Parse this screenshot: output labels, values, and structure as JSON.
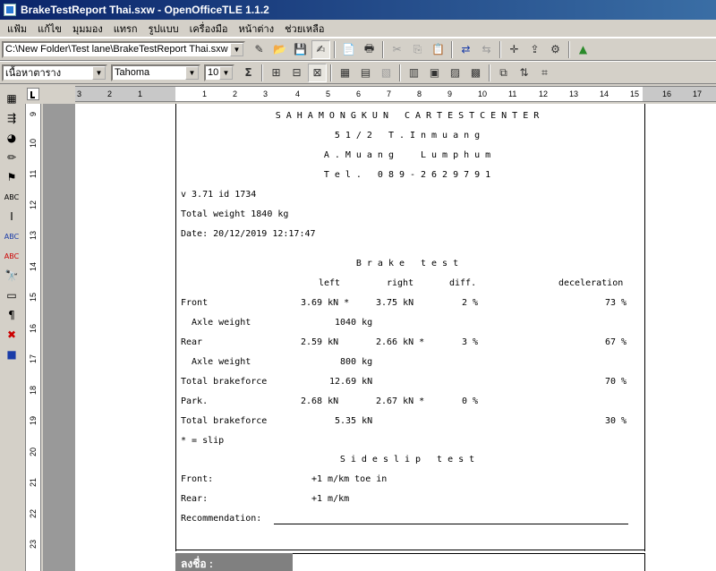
{
  "window": {
    "title": "BrakeTestReport Thai.sxw - OpenOfficeTLE 1.1.2"
  },
  "menu": [
    "แฟ้ม",
    "แก้ไข",
    "มุมมอง",
    "แทรก",
    "รูปแบบ",
    "เครื่องมือ",
    "หน้าต่าง",
    "ช่วยเหลือ"
  ],
  "toolbar": {
    "file_path": "C:\\New Folder\\Test lane\\BrakeTestReport Thai.sxw"
  },
  "format": {
    "paragraph_style": "เนื้อหาตาราง",
    "font_name": "Tahoma",
    "font_size": "10",
    "sum_symbol": "Σ"
  },
  "hruler_labels": [
    "3",
    "2",
    "1",
    "1",
    "2",
    "3",
    "4",
    "5",
    "6",
    "7",
    "8",
    "9",
    "10",
    "11",
    "12",
    "13",
    "14",
    "15",
    "16",
    "17"
  ],
  "vruler_labels": [
    "9",
    "10",
    "11",
    "12",
    "13",
    "14",
    "15",
    "16",
    "17",
    "18",
    "19",
    "20",
    "21",
    "22",
    "23"
  ],
  "report": {
    "header": [
      "SAHAMONGKUN CARTESTCENTER",
      "51/2 T.Inmuang",
      "A.Muang  Lumphum",
      "Tel. 089-2629791"
    ],
    "version": "v 3.71 id 1734",
    "total_weight": "Total weight 1840 kg",
    "date": "Date: 20/12/2019 12:17:47",
    "brake_title": "Brake test",
    "col_left": "left",
    "col_right": "right",
    "col_diff": "diff.",
    "col_decel": "deceleration",
    "rows": [
      {
        "label": "Front",
        "left": "3.69 kN *",
        "right": "3.75 kN",
        "diff": "2 %",
        "decel": "73 %"
      },
      {
        "label": "  Axle weight",
        "left": "1040 kg",
        "right": "",
        "diff": "",
        "decel": ""
      },
      {
        "label": "Rear",
        "left": "2.59 kN",
        "right": "2.66 kN *",
        "diff": "3 %",
        "decel": "67 %"
      },
      {
        "label": "  Axle weight",
        "left": "800 kg",
        "right": "",
        "diff": "",
        "decel": ""
      },
      {
        "label": "Total brakeforce",
        "left": "12.69 kN",
        "right": "",
        "diff": "",
        "decel": "70 %"
      },
      {
        "label": "Park.",
        "left": "2.68 kN",
        "right": "2.67 kN *",
        "diff": "0 %",
        "decel": ""
      },
      {
        "label": "Total brakeforce",
        "left": "5.35 kN",
        "right": "",
        "diff": "",
        "decel": "30 %"
      }
    ],
    "slip_note": "* = slip",
    "sideslip_title": "Sideslip test",
    "front_label": "Front:",
    "front_value": "+1 m/km toe in",
    "rear_label": "Rear:",
    "rear_value": "+1 m/km",
    "recommendation": "Recommendation:",
    "signature_label": "ลงชื่อ :"
  }
}
